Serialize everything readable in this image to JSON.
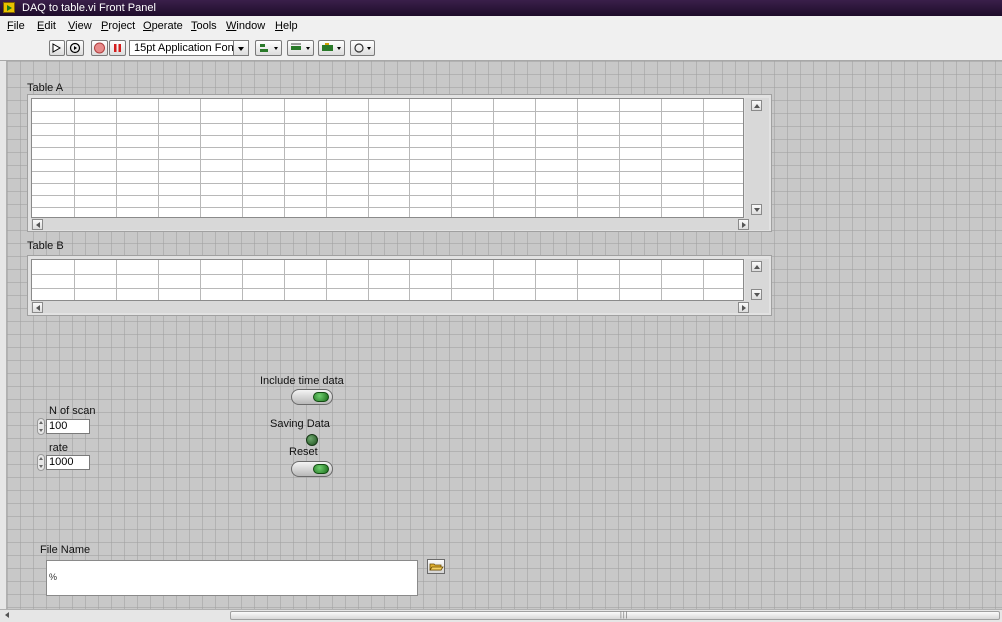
{
  "window": {
    "title": "DAQ to table.vi Front Panel"
  },
  "menu": {
    "items": [
      "File",
      "Edit",
      "View",
      "Project",
      "Operate",
      "Tools",
      "Window",
      "Help"
    ]
  },
  "toolbar": {
    "font_label": "15pt Application Font",
    "icons": [
      "run-arrow-icon",
      "run-continuously-icon",
      "abort-execution-icon",
      "pause-icon",
      "align-objects-icon",
      "distribute-objects-icon",
      "resize-objects-icon",
      "reorder-icon"
    ]
  },
  "table_a": {
    "label": "Table A",
    "rows": 10,
    "cols": 17
  },
  "table_b": {
    "label": "Table B",
    "rows": 3,
    "cols": 17
  },
  "controls": {
    "n_of_scan": {
      "label": "N of scan",
      "value": "100"
    },
    "rate": {
      "label": "rate",
      "value": "1000"
    },
    "include_time_data": {
      "label": "Include time data"
    },
    "saving_data": {
      "label": "Saving Data"
    },
    "reset": {
      "label": "Reset"
    },
    "file_name": {
      "label": "File Name",
      "value": ""
    }
  },
  "colors": {
    "title_bar": "#2a1538",
    "panel_grid": "#c8c8c8",
    "led_green": "#2e6b2e",
    "toggle_green": "#3aa33a",
    "abort_red": "#d41c1c"
  }
}
